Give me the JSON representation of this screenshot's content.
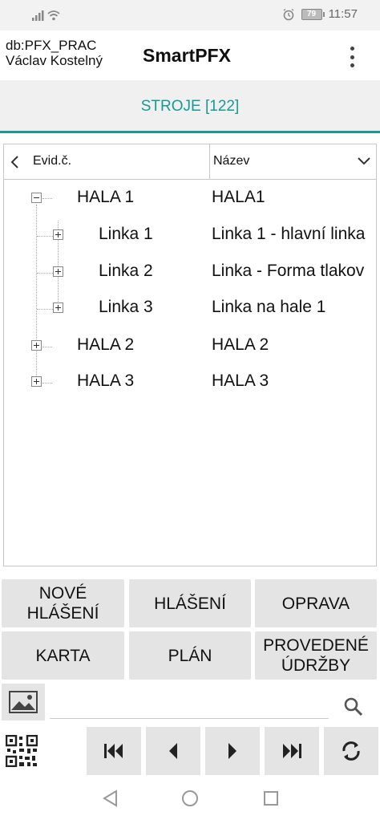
{
  "status_bar": {
    "battery": "79",
    "time": "11:57"
  },
  "header": {
    "db": "db:PFX_PRAC",
    "user": "Václav Kostelný",
    "title": "SmartPFX"
  },
  "tab": {
    "label": "STROJE [122]"
  },
  "tree": {
    "columns": {
      "col1": "Evid.č.",
      "col2": "Název"
    },
    "rows": [
      {
        "name": "HALA 1",
        "desc": "HALA1",
        "expanded": true,
        "level": 0
      },
      {
        "name": "Linka 1",
        "desc": "Linka 1 - hlavní linka",
        "expanded": false,
        "level": 1
      },
      {
        "name": "Linka 2",
        "desc": "Linka - Forma tlakov",
        "expanded": false,
        "level": 1
      },
      {
        "name": "Linka 3",
        "desc": "Linka na hale 1",
        "expanded": false,
        "level": 1
      },
      {
        "name": "HALA 2",
        "desc": "HALA 2",
        "expanded": false,
        "level": 0
      },
      {
        "name": "HALA 3",
        "desc": "HALA 3",
        "expanded": false,
        "level": 0
      }
    ]
  },
  "actions": {
    "new_report_line1": "NOVÉ",
    "new_report_line2": "HLÁŠENÍ",
    "reports": "HLÁŠENÍ",
    "repair": "OPRAVA",
    "card": "KARTA",
    "plan": "PLÁN",
    "maintenance_line1": "PROVEDENÉ",
    "maintenance_line2": "ÚDRŽBY"
  },
  "search": {
    "value": ""
  },
  "icons": {
    "image": "image-icon",
    "search": "search-icon",
    "qr": "qr-code-icon",
    "first": "skip-first-icon",
    "prev": "prev-icon",
    "next": "next-icon",
    "last": "skip-last-icon",
    "refresh": "refresh-icon"
  },
  "colors": {
    "accent": "#149c94",
    "button_bg": "#e4e4e4"
  }
}
